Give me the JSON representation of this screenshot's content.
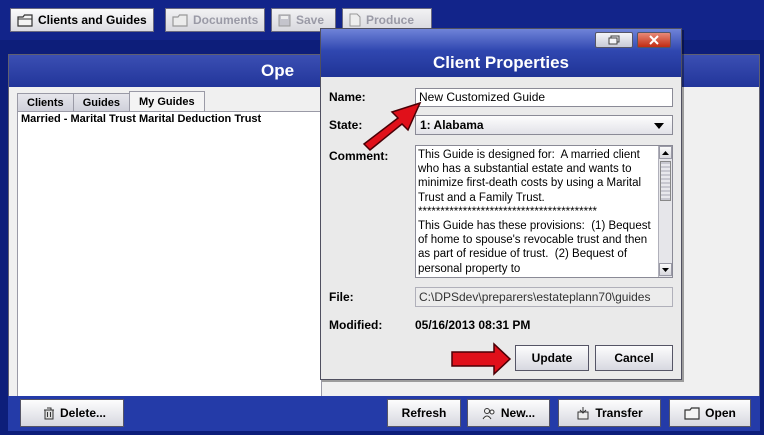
{
  "toolbar": {
    "clients_guides": "Clients and Guides",
    "documents": "Documents",
    "save": "Save",
    "produce": "Produce"
  },
  "main": {
    "title": "Ope",
    "tabs": [
      {
        "label": "Clients"
      },
      {
        "label": "Guides"
      },
      {
        "label": "My Guides"
      }
    ],
    "list": [
      "Married - Marital Trust Marital Deduction Trust"
    ],
    "buttons": {
      "delete": "Delete...",
      "refresh": "Refresh",
      "new": "New...",
      "transfer": "Transfer",
      "open": "Open"
    }
  },
  "dialog": {
    "title": "Client Properties",
    "name_label": "Name:",
    "name_value": "New Customized Guide",
    "state_label": "State:",
    "state_value": "1: Alabama",
    "comment_label": "Comment:",
    "comment_text": "This Guide is designed for:  A married client who has a substantial estate and wants to minimize first-death costs by using a Marital Trust and a Family Trust.\n****************************************\nThis Guide has these provisions:  (1) Bequest of home to spouse's revocable trust and then as part of residue of trust.  (2) Bequest of personal property to",
    "file_label": "File:",
    "file_value": "C:\\DPSdev\\preparers\\estateplann70\\guides",
    "modified_label": "Modified:",
    "modified_value": "05/16/2013 08:31 PM",
    "update": "Update",
    "cancel": "Cancel"
  },
  "colors": {
    "annotation_arrow": "#e0101a",
    "background": "#0d1e7a"
  }
}
